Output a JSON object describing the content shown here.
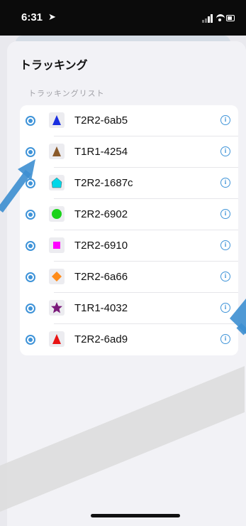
{
  "status_bar": {
    "time": "6:31"
  },
  "sheet": {
    "title": "トラッキング",
    "section_header": "トラッキングリスト"
  },
  "tracking_list": [
    {
      "label": "T2R2-6ab5",
      "symbol": "triangle",
      "color": "#1a2fe0"
    },
    {
      "label": "T1R1-4254",
      "symbol": "triangle",
      "color": "#8a5a2b"
    },
    {
      "label": "T2R2-1687c",
      "symbol": "pentagon",
      "color": "#00d7e8"
    },
    {
      "label": "T2R2-6902",
      "symbol": "circle",
      "color": "#1ad31a"
    },
    {
      "label": "T2R2-6910",
      "symbol": "square",
      "color": "#ff00ff"
    },
    {
      "label": "T2R2-6a66",
      "symbol": "diamond",
      "color": "#ff8c1a"
    },
    {
      "label": "T1R1-4032",
      "symbol": "star",
      "color": "#7a1a7a"
    },
    {
      "label": "T2R2-6ad9",
      "symbol": "triangle",
      "color": "#e81414"
    }
  ],
  "colors": {
    "accent": "#3e93d8",
    "annotation_arrow": "#3d8fd1"
  }
}
